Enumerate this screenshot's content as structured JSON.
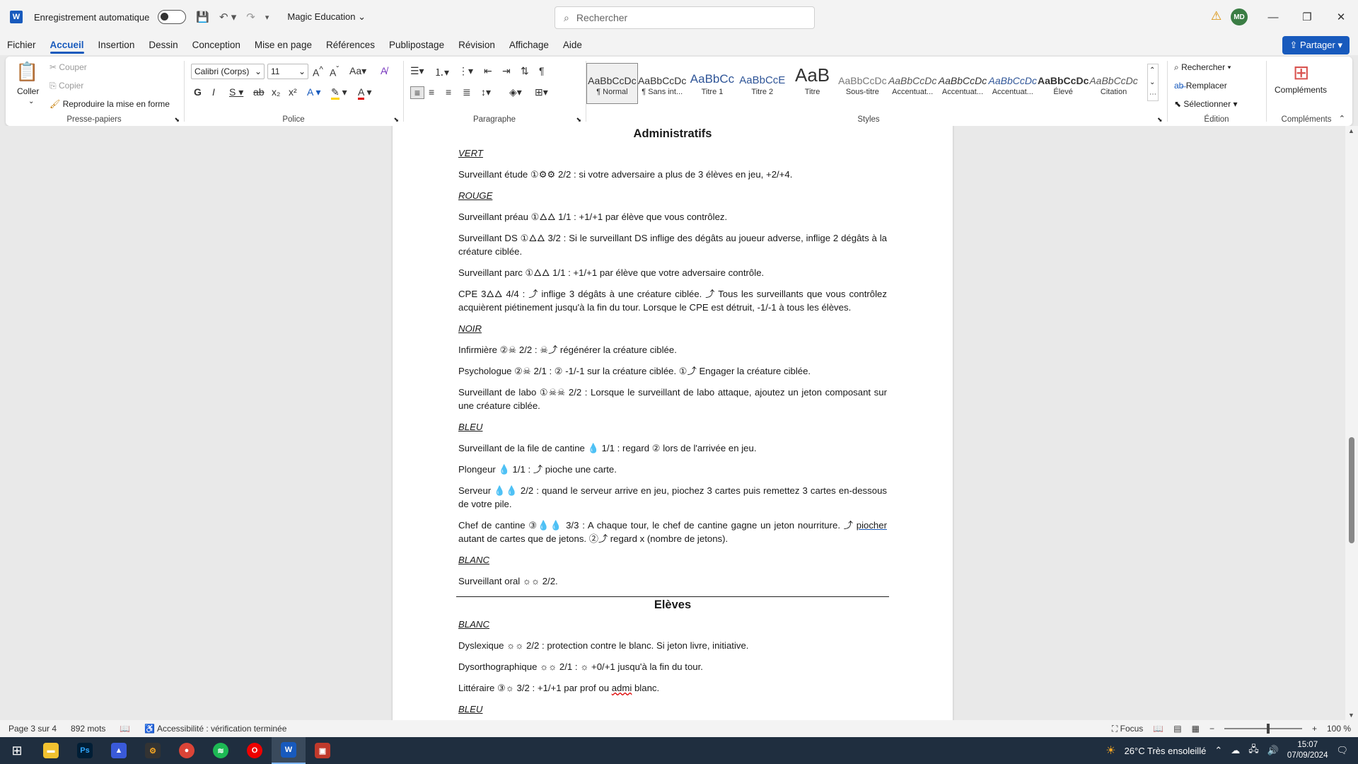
{
  "titlebar": {
    "autosave_label": "Enregistrement automatique",
    "doc_name": "Magic Education",
    "search_placeholder": "Rechercher",
    "avatar_initials": "MD"
  },
  "tabs": [
    "Fichier",
    "Accueil",
    "Insertion",
    "Dessin",
    "Conception",
    "Mise en page",
    "Références",
    "Publipostage",
    "Révision",
    "Affichage",
    "Aide"
  ],
  "share_label": "Partager",
  "ribbon": {
    "clipboard": {
      "paste": "Coller",
      "cut": "Couper",
      "copy": "Copier",
      "format_painter": "Reproduire la mise en forme",
      "label": "Presse-papiers"
    },
    "font": {
      "name": "Calibri (Corps)",
      "size": "11",
      "label": "Police"
    },
    "paragraph": {
      "label": "Paragraphe"
    },
    "styles": {
      "label": "Styles",
      "items": [
        {
          "preview": "AaBbCcDc",
          "name": "¶ Normal"
        },
        {
          "preview": "AaBbCcDc",
          "name": "¶ Sans int..."
        },
        {
          "preview": "AaBbCc",
          "name": "Titre 1"
        },
        {
          "preview": "AaBbCcE",
          "name": "Titre 2"
        },
        {
          "preview": "AaB",
          "name": "Titre"
        },
        {
          "preview": "AaBbCcDc",
          "name": "Sous-titre"
        },
        {
          "preview": "AaBbCcDc",
          "name": "Accentuat..."
        },
        {
          "preview": "AaBbCcDc",
          "name": "Accentuat..."
        },
        {
          "preview": "AaBbCcDc",
          "name": "Accentuat..."
        },
        {
          "preview": "AaBbCcDc",
          "name": "Élevé"
        },
        {
          "preview": "AaBbCcDc",
          "name": "Citation"
        }
      ]
    },
    "editing": {
      "find": "Rechercher",
      "replace": "Remplacer",
      "select": "Sélectionner",
      "label": "Édition"
    },
    "addins": {
      "button": "Compléments",
      "label": "Compléments"
    }
  },
  "document": {
    "heading1": "Administratifs",
    "sec_vert": "VERT",
    "p_etude": "Surveillant étude ①⚙⚙ 2/2 : si votre adversaire a plus de 3 élèves en jeu, +2/+4.",
    "sec_rouge": "ROUGE",
    "p_preau": "Surveillant préau ①🜂🜂 1/1 : +1/+1 par élève que vous contrôlez.",
    "p_ds": "Surveillant DS ①🜂🜂 3/2 : Si le surveillant DS inflige des dégâts au joueur adverse, inflige 2 dégâts à la créature ciblée.",
    "p_parc": "Surveillant parc ①🜂🜂 1/1 : +1/+1 par élève que votre adversaire contrôle.",
    "p_cpe": "CPE 3🜂🜂 4/4 : ⤴ inflige 3 dégâts à une créature ciblée. ⤴ Tous les surveillants que vous contrôlez acquièrent piétinement jusqu'à la fin du tour. Lorsque le CPE est détruit, -1/-1 à tous les élèves.",
    "sec_noir": "NOIR",
    "p_infirmiere": "Infirmière ②☠ 2/2 : ☠⤴ régénérer la créature ciblée.",
    "p_psy": "Psychologue ②☠ 2/1 : ② -1/-1 sur la créature ciblée. ①⤴ Engager la créature ciblée.",
    "p_labo": "Surveillant de labo ①☠☠ 2/2 : Lorsque le surveillant de labo attaque, ajoutez un jeton composant sur une créature ciblée.",
    "sec_bleu": "BLEU",
    "p_file": "Surveillant de la file de cantine 💧 1/1 : regard ② lors de l'arrivée en jeu.",
    "p_plongeur": "Plongeur 💧 1/1 : ⤴ pioche une carte.",
    "p_serveur": "Serveur 💧💧 2/2 : quand le serveur arrive en jeu, piochez 3 cartes puis remettez 3 cartes en-dessous de votre pile.",
    "p_chef_a": "Chef de cantine ③💧💧 3/3 : A chaque tour, le chef de cantine gagne un jeton nourriture. ⤴ ",
    "p_chef_link": "piocher",
    "p_chef_b": " autant de cartes que de jetons. ②⤴  regard x (nombre de jetons).",
    "sec_blanc": "BLANC",
    "p_oral": "Surveillant oral ☼☼ 2/2.",
    "heading2": "Elèves",
    "sec_blanc2": "BLANC",
    "p_dyslexique": "Dyslexique ☼☼ 2/2 : protection contre le blanc. Si jeton livre, initiative.",
    "p_dysortho": "Dysorthographique ☼☼ 2/1 : ☼ +0/+1 jusqu'à la fin du tour.",
    "p_litt_a": "Littéraire ③☼ 3/2 : +1/+1 par prof ou ",
    "p_litt_sq": "admi",
    "p_litt_b": " blanc.",
    "sec_bleu2": "BLEU"
  },
  "status": {
    "page": "Page 3 sur 4",
    "words": "892 mots",
    "accessibility": "Accessibilité : vérification terminée",
    "focus": "Focus",
    "zoom": "100 %"
  },
  "taskbar": {
    "weather": "26°C  Très ensoleillé",
    "time": "15:07",
    "date": "07/09/2024"
  }
}
